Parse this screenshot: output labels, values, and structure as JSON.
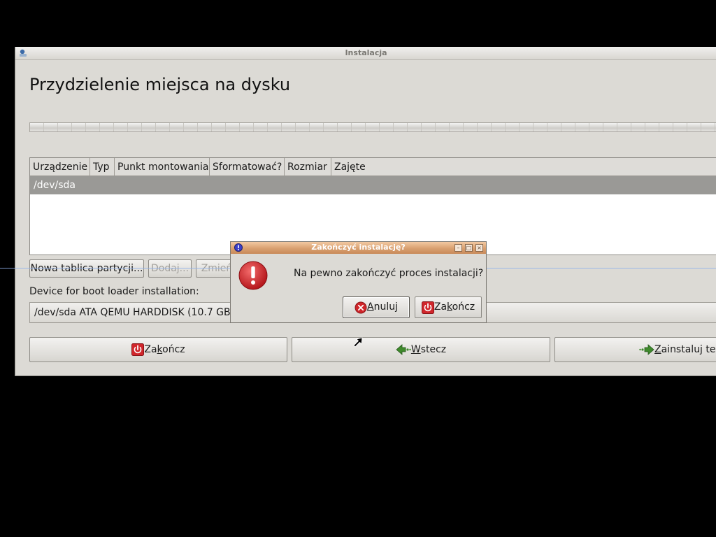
{
  "window": {
    "title": "Instalacja",
    "heading": "Przydzielenie miejsca na dysku"
  },
  "partition_table": {
    "columns": [
      "Urządzenie",
      "Typ",
      "Punkt montowania",
      "Sformatować?",
      "Rozmiar",
      "Zajęte"
    ],
    "rows": [
      {
        "device": "/dev/sda",
        "selected": true
      }
    ]
  },
  "partition_buttons": {
    "new_table": "Nowa tablica partycji...",
    "add": "Dodaj...",
    "change": "Zmień"
  },
  "bootloader": {
    "label": "Device for boot loader installation:",
    "selected": "/dev/sda ATA QEMU HARDDISK (10.7 GB)"
  },
  "nav": {
    "quit": {
      "pre": "Za",
      "mnemonic": "k",
      "post": "ończ"
    },
    "back": {
      "pre": "",
      "mnemonic": "W",
      "post": "stecz"
    },
    "install": {
      "pre": "",
      "mnemonic": "Z",
      "post": "ainstaluj teraz"
    }
  },
  "dialog": {
    "title": "Zakończyć instalację?",
    "message": "Na pewno zakończyć proces instalacji?",
    "cancel": {
      "pre": "",
      "mnemonic": "A",
      "post": "nuluj"
    },
    "quit": {
      "pre": "Za",
      "mnemonic": "k",
      "post": "ończ"
    }
  },
  "colors": {
    "window_bg": "#dcdad5",
    "selection": "#9a9996",
    "dialog_titlebar": "#d9a070",
    "error_red": "#d0262b",
    "nav_green": "#3f8a2c"
  }
}
